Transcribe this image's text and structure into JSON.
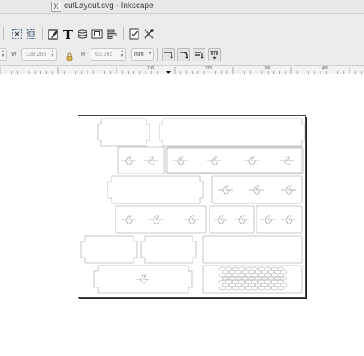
{
  "window": {
    "title": "cutLayout.svg - Inkscape",
    "app_icon": "x11-app-icon"
  },
  "toolbar": {
    "icons": [
      "select-all-icon",
      "select-all-in-all-layers-icon",
      "fill-and-stroke-icon",
      "text-and-font-icon",
      "objects-icon",
      "document-properties-icon",
      "align-and-distribute-icon",
      "preferences-icon",
      "xml-editor-icon"
    ]
  },
  "controls": {
    "x_field_label": "X",
    "w_label": "W",
    "w_value": "128.265",
    "h_label": "H",
    "h_value": "60.265",
    "unit": "mm",
    "transform_icons": [
      "scale-stroke-icon",
      "scale-corners-icon",
      "move-gradients-icon",
      "move-patterns-icon"
    ]
  },
  "ruler": {
    "labels": [
      "100",
      "200",
      "300",
      "400",
      "500"
    ]
  },
  "colors": {
    "chrome": "#ececec",
    "titlebar": "#e8e8e8",
    "cut_stroke": "#b8b8b8",
    "page_border": "#444444"
  }
}
